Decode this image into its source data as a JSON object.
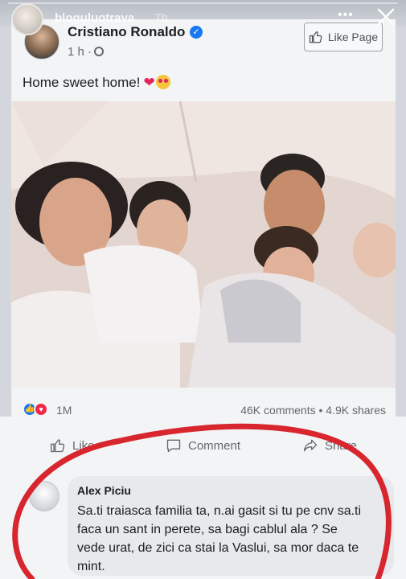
{
  "story": {
    "username": "bloguluotrava",
    "time": "7h",
    "more_icon": "ellipsis-icon",
    "close_icon": "close-icon"
  },
  "post": {
    "author": "Cristiano Ronaldo",
    "verified": true,
    "time": "1 h ·",
    "like_page_label": "Like Page",
    "text": "Home sweet home!",
    "emojis": [
      "red-heart-icon",
      "heart-eyes-icon"
    ]
  },
  "stats": {
    "reactions_count": "1M",
    "comments_shares": "46K comments • 4.9K shares"
  },
  "actions": {
    "like_label": "Like",
    "comment_label": "Comment",
    "share_label": "Share"
  },
  "comment": {
    "author": "Alex Piciu",
    "text": "Sa.ti traiasca familia ta, n.ai gasit si tu pe cnv sa.ti faca un sant in perete, sa bagi cablul ala ? Se vede urat, de zici ca stai la Vaslui, sa mor daca te mint."
  },
  "colors": {
    "facebook_blue": "#1877f2",
    "love_red": "#f02849",
    "annotation_red": "#d8262e"
  }
}
